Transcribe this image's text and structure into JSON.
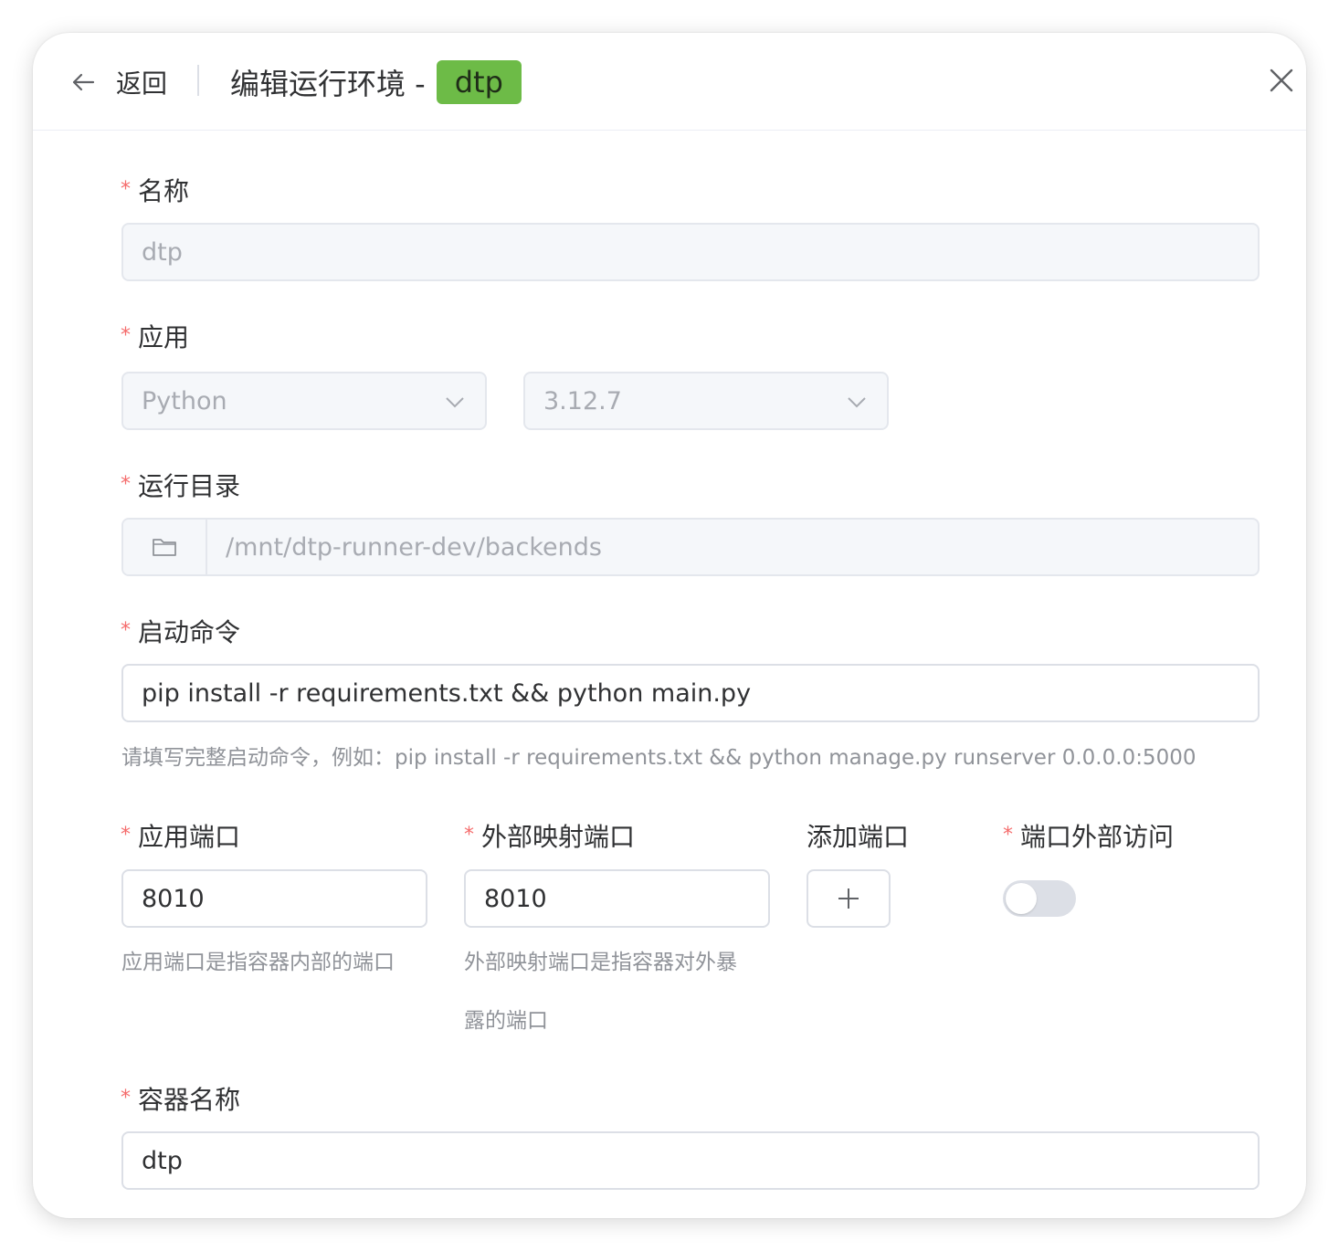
{
  "header": {
    "back_label": "返回",
    "title": "编辑运行环境 -",
    "tag": "dtp"
  },
  "form": {
    "name": {
      "label": "名称",
      "value": "dtp"
    },
    "app": {
      "label": "应用",
      "runtime": "Python",
      "version": "3.12.7"
    },
    "dir": {
      "label": "运行目录",
      "value": "/mnt/dtp-runner-dev/backends"
    },
    "command": {
      "label": "启动命令",
      "value": "pip install -r requirements.txt && python main.py",
      "hint": "请填写完整启动命令，例如：pip install -r requirements.txt && python manage.py runserver 0.0.0.0:5000"
    },
    "app_port": {
      "label": "应用端口",
      "value": "8010",
      "hint": "应用端口是指容器内部的端口"
    },
    "ext_port": {
      "label": "外部映射端口",
      "value": "8010",
      "hint_line1": "外部映射端口是指容器对外暴",
      "hint_line2": "露的端口"
    },
    "add_port": {
      "label": "添加端口"
    },
    "external_access": {
      "label": "端口外部访问",
      "enabled": false
    },
    "container": {
      "label": "容器名称",
      "value": "dtp"
    }
  },
  "colors": {
    "accent_tag": "#6dbb47",
    "required": "#f56c6c",
    "hint": "#909399"
  }
}
